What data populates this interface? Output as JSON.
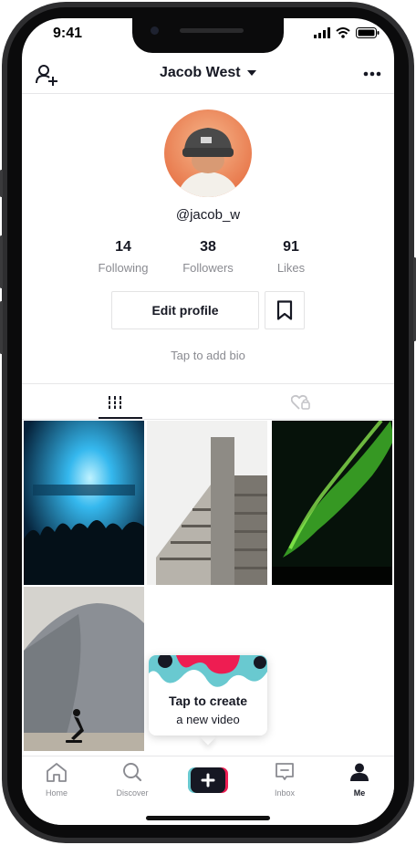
{
  "status_bar": {
    "time": "9:41"
  },
  "header": {
    "title": "Jacob West",
    "add_user_icon": "add-user-icon",
    "more_icon": "more-icon",
    "dropdown_icon": "caret-down-icon"
  },
  "profile": {
    "username": "@jacob_w",
    "stats": [
      {
        "value": "14",
        "label": "Following"
      },
      {
        "value": "38",
        "label": "Followers"
      },
      {
        "value": "91",
        "label": "Likes"
      }
    ],
    "edit_button": "Edit profile",
    "bookmark_icon": "bookmark-icon",
    "bio_placeholder": "Tap to add bio"
  },
  "tabs": [
    {
      "icon": "grid-icon",
      "active": true
    },
    {
      "icon": "liked-hidden-icon",
      "active": false
    }
  ],
  "videos": [
    {
      "subject": "concert-stage"
    },
    {
      "subject": "concrete-building"
    },
    {
      "subject": "aurora"
    },
    {
      "subject": "skateboarder-cliff"
    }
  ],
  "tooltip": {
    "line1": "Tap to create",
    "line2": "a new video"
  },
  "bottom_nav": {
    "items": [
      {
        "label": "Home",
        "icon": "home-icon"
      },
      {
        "label": "Discover",
        "icon": "search-icon"
      },
      {
        "label": "",
        "icon": "plus-icon"
      },
      {
        "label": "Inbox",
        "icon": "inbox-icon"
      },
      {
        "label": "Me",
        "icon": "person-icon"
      }
    ]
  },
  "colors": {
    "accent_pink": "#ee1d52",
    "accent_cyan": "#69c9d0",
    "text": "#161823",
    "muted": "#8a8b91"
  }
}
